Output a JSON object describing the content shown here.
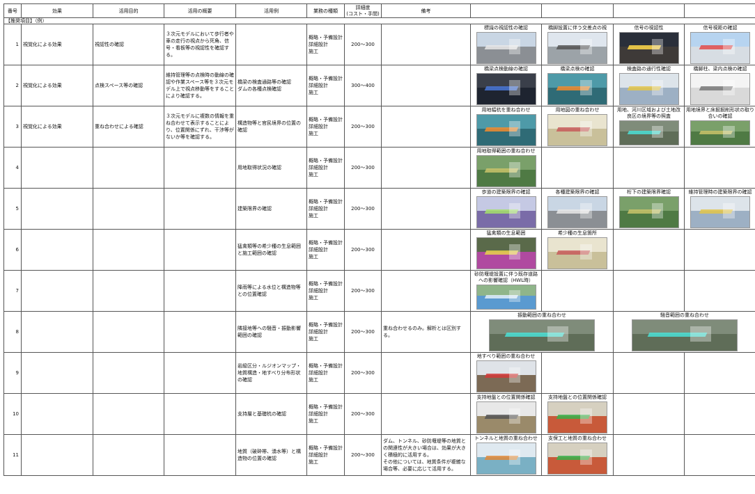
{
  "headers": {
    "no": "番号",
    "effect": "効果",
    "purpose": "活用目的",
    "overview": "活用の概要",
    "example": "活用例",
    "phase": "業務の種類",
    "detail": "詳細度\n(コスト・手間)",
    "remarks": "備考"
  },
  "section_label": "【推奨項目】（例）",
  "rows": [
    {
      "no": "1",
      "effect": "視覚化による効果",
      "purpose": "視認性の確認",
      "overview": "３次元モデルにおいて歩行者や車の走行の視点から死角、信号・看板等の視認性を確認する。",
      "example": "",
      "phase": "概略・予備設計\n詳細設計\n施工",
      "cost": "200～300",
      "remarks": "",
      "images": [
        {
          "caption": "標識の視認性の確認",
          "style": "road"
        },
        {
          "caption": "橋脚設置に伴う交差点の視",
          "style": "bridge"
        },
        {
          "caption": "信号の視認性",
          "style": "night"
        },
        {
          "caption": "信号視距の確認",
          "style": "sky"
        }
      ]
    },
    {
      "no": "2",
      "effect": "視覚化による効果",
      "purpose": "点検スペース等の確認",
      "overview": "維持管理等の点検時の動線の確認や作業スペース等を３次元モデル上で視点移動等をすることにより確認する。",
      "example": "橋梁の検査通路等の確認\nダムの各種点検確認",
      "phase": "概略・予備設計\n詳細設計\n施工",
      "cost": "300～400",
      "remarks": "",
      "images": [
        {
          "caption": "橋梁点検動線の確認",
          "style": "dark"
        },
        {
          "caption": "橋梁点検の確認",
          "style": "teal"
        },
        {
          "caption": "検査路の通行性確認",
          "style": "structure"
        },
        {
          "caption": "橋脚柱、梁内点検の確認",
          "style": "white"
        }
      ]
    },
    {
      "no": "3",
      "effect": "視覚化による効果",
      "purpose": "重ね合わせによる確認",
      "overview": "３次元モデルに複数の情報を重ね合わせて表示することにより、位置関係にずれ、干渉等がないか等を確認する。",
      "example": "構造物等と官民境界の位置の確認",
      "phase": "概略・予備設計\n詳細設計\n施工",
      "cost": "200～300",
      "remarks": "",
      "images": [
        {
          "caption": "用地幅杭を重ね合わせ",
          "style": "teal"
        },
        {
          "caption": "用地図の重ね合わせ",
          "style": "map"
        },
        {
          "caption": "用地、河川区域および土地改良区の境界等の照査",
          "style": "aerial",
          "wrap": true
        },
        {
          "caption": "用地境界と床掘掘削形状の取り合いの確認",
          "style": "green",
          "wrap": true
        }
      ]
    },
    {
      "no": "4",
      "effect": "",
      "purpose": "",
      "overview": "",
      "example": "用地取得状況の確認",
      "phase": "概略・予備設計\n詳細設計\n施工",
      "cost": "200～300",
      "remarks": "",
      "images": [
        {
          "caption": "用地取得範囲の重ね合わせ",
          "style": "green"
        }
      ]
    },
    {
      "no": "5",
      "effect": "",
      "purpose": "",
      "overview": "",
      "example": "建築限界の確認",
      "phase": "概略・予備設計\n詳細設計\n施工",
      "cost": "200～300",
      "remarks": "",
      "images": [
        {
          "caption": "歩道の建築限界の確認",
          "style": "purple"
        },
        {
          "caption": "各種建築限界の確認",
          "style": "road"
        },
        {
          "caption": "桁下の建築限界確認",
          "style": "green"
        },
        {
          "caption": "維持管理時の建築限界の確認",
          "style": "structure"
        }
      ]
    },
    {
      "no": "6",
      "effect": "",
      "purpose": "",
      "overview": "",
      "example": "猛禽類等の希少種の生息範囲と施工範囲の確認",
      "phase": "概略・予備設計\n詳細設計\n施工",
      "cost": "200～300",
      "remarks": "",
      "images": [
        {
          "caption": "猛禽類の生息範囲",
          "style": "magenta"
        },
        {
          "caption": "希少種の生息箇所",
          "style": "map"
        }
      ]
    },
    {
      "no": "7",
      "effect": "",
      "purpose": "",
      "overview": "",
      "example": "降雨等による水位と構造物等との位置確認",
      "phase": "概略・予備設計\n詳細設計\n施工",
      "cost": "200～300",
      "remarks": "",
      "images": [
        {
          "caption": "砂防堰堤設置に伴う既存道路への影響確認（HWL時）",
          "style": "water",
          "wrap": true
        }
      ]
    },
    {
      "no": "8",
      "effect": "",
      "purpose": "",
      "overview": "",
      "example": "隣接地等への騒音・振動影響範囲の確認",
      "phase": "概略・予備設計\n詳細設計\n施工",
      "cost": "200～300",
      "remarks": "重ね合わせるのみ。解析とは区別する。",
      "images": [
        {
          "caption": "振動範囲の重ね合わせ",
          "style": "aerial",
          "wide": true
        },
        {
          "caption": "騒音範囲の重ね合わせ",
          "style": "aerial",
          "wide": true
        }
      ]
    },
    {
      "no": "9",
      "effect": "",
      "purpose": "",
      "overview": "",
      "example": "岩級区分・ルジオンマップ・地質構造・地すべり分布形状の確認",
      "phase": "概略・予備設計\n詳細設計\n施工",
      "cost": "200～300",
      "remarks": "",
      "images": [
        {
          "caption": "地すべり範囲の重ね合わせ",
          "style": "slide"
        }
      ]
    },
    {
      "no": "10",
      "effect": "",
      "purpose": "",
      "overview": "",
      "example": "支持層と基礎杭の確認",
      "phase": "概略・予備設計\n詳細設計\n施工",
      "cost": "200～300",
      "remarks": "",
      "images": [
        {
          "caption": "支持地盤との位置関係確認",
          "style": "pile"
        },
        {
          "caption": "支持地盤との位置関係確認",
          "style": "layers"
        }
      ]
    },
    {
      "no": "11",
      "effect": "",
      "purpose": "",
      "overview": "",
      "example": "地質（破砕帯、湧水等）と構造物の位置の確認",
      "phase": "概略・予備設計\n詳細設計\n施工",
      "cost": "200～300",
      "remarks": "ダム、トンネル、砂防堰堤等の地質との関連性が大きい場合は、効果が大きく積極的に活用する。\nその他については、地質条件が複雑な場合等、必要に応じて活用する。",
      "images": [
        {
          "caption": "トンネルと地質の重ね合わせ",
          "style": "tunnel"
        },
        {
          "caption": "支保工と地質の重ね合わせ",
          "style": "layers"
        }
      ]
    }
  ]
}
